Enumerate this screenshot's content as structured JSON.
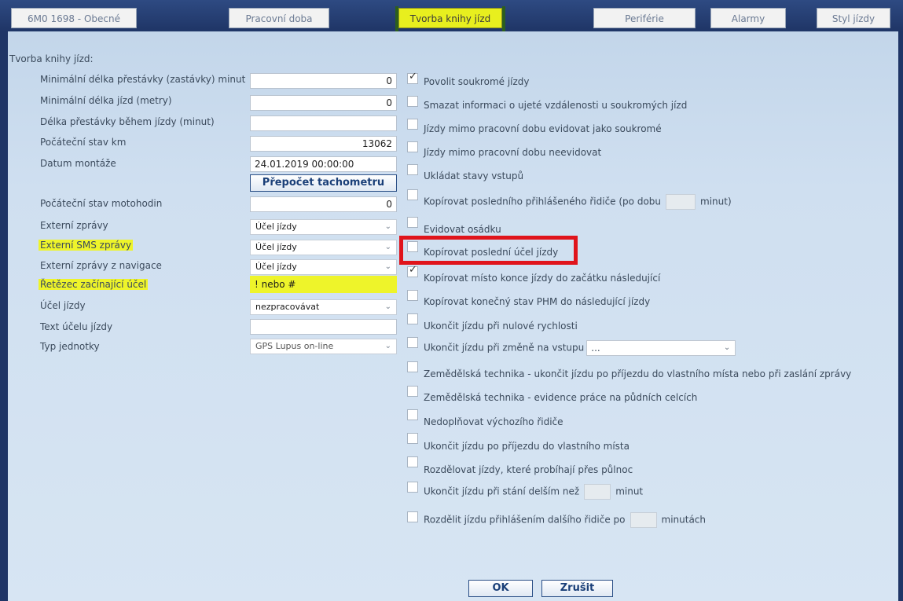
{
  "tabs": [
    {
      "label": "6M0 1698 - Obecné",
      "active": false
    },
    {
      "label": "Pracovní doba",
      "active": false
    },
    {
      "label": "Tvorba knihy jízd",
      "active": true
    },
    {
      "label": "Periférie",
      "active": false
    },
    {
      "label": "Alarmy",
      "active": false
    },
    {
      "label": "Styl jízdy",
      "active": false
    }
  ],
  "section_title": "Tvorba knihy jízd:",
  "form": {
    "min_stop_label": "Minimální délka přestávky (zastávky) minut",
    "min_stop_value": "0",
    "min_trip_label": "Minimální délka jízd (metry)",
    "min_trip_value": "0",
    "break_label": "Délka přestávky během jízdy (minut)",
    "break_value": "",
    "start_km_label": "Počáteční stav km",
    "start_km_value": "13062",
    "install_date_label": "Datum montáže",
    "install_date_value": "24.01.2019 00:00:00",
    "recalc_button": "Přepočet tachometru",
    "start_hours_label": "Počáteční stav motohodin",
    "start_hours_value": "0",
    "ext_msg_label": "Externí zprávy",
    "ext_msg_value": "Účel jízdy",
    "ext_sms_label": "Externí SMS zprávy",
    "ext_sms_value": "Účel jízdy",
    "ext_nav_label": "Externí zprávy z navigace",
    "ext_nav_value": "Účel jízdy",
    "chain_label": "Řetězec začínající účel",
    "chain_value": "! nebo #",
    "purpose_label": "Účel jízdy",
    "purpose_value": "nezpracovávat",
    "purpose_text_label": "Text účelu jízdy",
    "purpose_text_value": "",
    "unit_type_label": "Typ jednotky",
    "unit_type_value": "GPS Lupus on-line"
  },
  "options": [
    {
      "label": "Povolit soukromé jízdy",
      "checked": true
    },
    {
      "label": "Smazat informaci o ujeté vzdálenosti u soukromých jízd",
      "checked": false
    },
    {
      "label": "Jízdy mimo pracovní dobu evidovat jako soukromé",
      "checked": false
    },
    {
      "label": "Jízdy mimo pracovní dobu neevidovat",
      "checked": false
    },
    {
      "label": "Ukládat stavy vstupů",
      "checked": false
    },
    {
      "label": "Kopírovat posledního přihlášeného řidiče (po dobu",
      "suffix": "minut)",
      "checked": false
    },
    {
      "label": "Evidovat osádku",
      "checked": false
    },
    {
      "label": "Kopírovat poslední účel jízdy",
      "checked": false
    },
    {
      "label": "Kopírovat místo konce jízdy do začátku následující",
      "checked": true
    },
    {
      "label": "Kopírovat konečný stav PHM do následující jízdy",
      "checked": false
    },
    {
      "label": "Ukončit jízdu při nulové rychlosti",
      "checked": false
    },
    {
      "label": "Ukončit jízdu při změně na vstupu",
      "select_value": "...",
      "checked": false
    },
    {
      "label": "Zemědělská technika - ukončit jízdu po příjezdu do vlastního místa nebo při zaslání zprávy",
      "checked": false
    },
    {
      "label": "Zemědělská technika - evidence práce na půdních celcích",
      "checked": false
    },
    {
      "label": "Nedoplňovat výchozího řidiče",
      "checked": false
    },
    {
      "label": "Ukončit jízdu po příjezdu do vlastního místa",
      "checked": false
    },
    {
      "label": "Rozdělovat jízdy, které probíhají přes půlnoc",
      "checked": false
    },
    {
      "label": "Ukončit jízdu při stání delším než",
      "suffix": "minut",
      "checked": false
    },
    {
      "label": "Rozdělit jízdu přihlášením dalšího řidiče po",
      "suffix": "minutách",
      "checked": false
    }
  ],
  "buttons": {
    "ok": "OK",
    "cancel": "Zrušit"
  }
}
